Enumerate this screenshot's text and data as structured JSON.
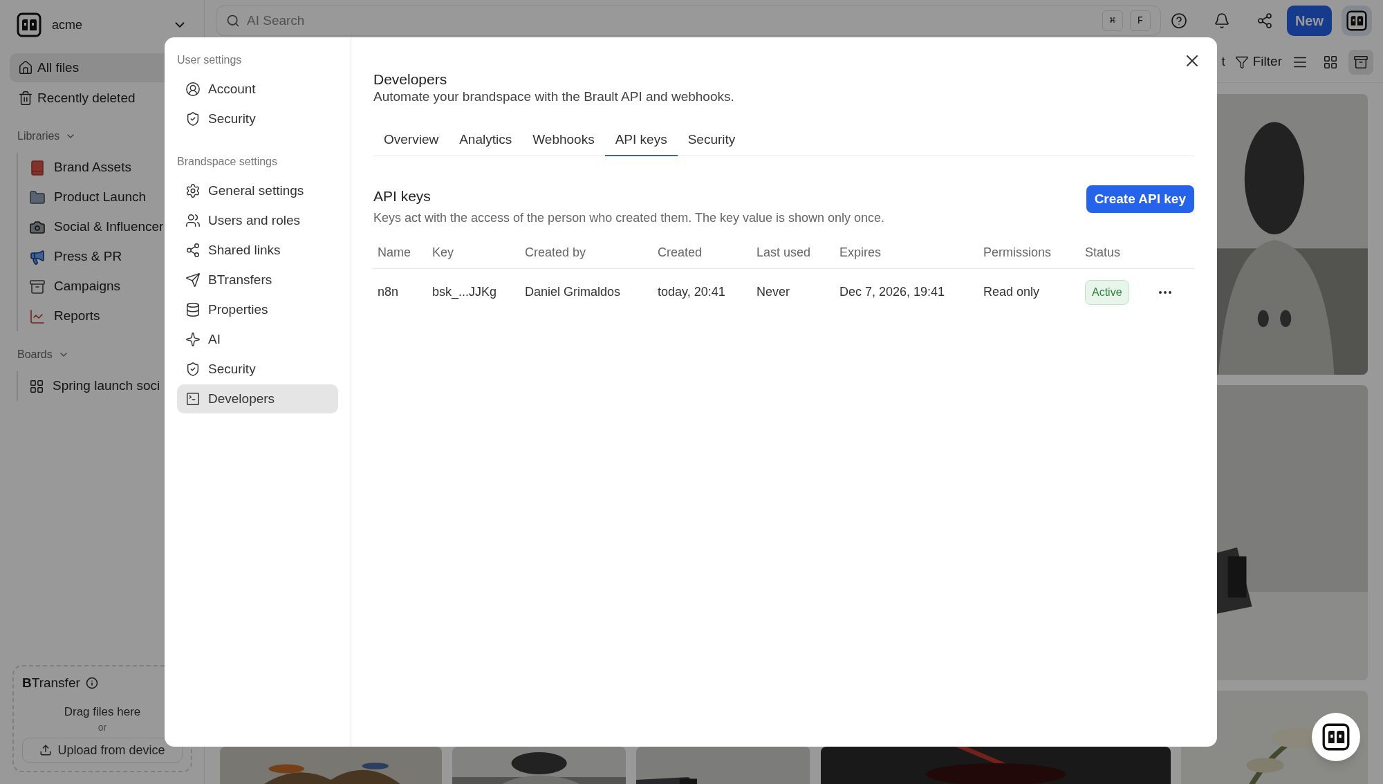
{
  "sidebar": {
    "workspace": "acme",
    "nav": [
      {
        "label": "All files",
        "selected": true
      },
      {
        "label": "Recently deleted",
        "selected": false
      }
    ],
    "sections": [
      {
        "title": "Libraries",
        "items": [
          "Brand Assets",
          "Product Launch",
          "Social & Influencer",
          "Press & PR",
          "Campaigns",
          "Reports"
        ]
      },
      {
        "title": "Boards",
        "items": [
          "Spring launch soci"
        ]
      }
    ],
    "btransfer": {
      "title": "**B**Transfer",
      "hint": "Drag files here",
      "or": "or",
      "button": "Upload from device"
    }
  },
  "topbar": {
    "search_placeholder": "AI Search",
    "keys": [
      "⌘",
      "F"
    ],
    "new_button": "New"
  },
  "toolbar": {
    "cut_text": "t",
    "filter": "Filter",
    "views": [
      {
        "selected": false
      },
      {
        "selected": false
      },
      {
        "selected": true
      }
    ]
  },
  "modal": {
    "nav": [
      {
        "title": "User settings",
        "items": [
          {
            "label": "Account",
            "selected": false
          },
          {
            "label": "Security",
            "selected": false
          }
        ]
      },
      {
        "title": "Brandspace settings",
        "items": [
          {
            "label": "General settings",
            "selected": false
          },
          {
            "label": "Users and roles",
            "selected": false
          },
          {
            "label": "Shared links",
            "selected": false
          },
          {
            "label": "BTransfers",
            "selected": false
          },
          {
            "label": "Properties",
            "selected": false
          },
          {
            "label": "AI",
            "selected": false
          },
          {
            "label": "Security",
            "selected": false
          },
          {
            "label": "Developers",
            "selected": true
          }
        ]
      }
    ],
    "title": "Developers",
    "subtitle": "Automate your brandspace with the Brault API and webhooks.",
    "tabs": [
      {
        "label": "Overview",
        "selected": false
      },
      {
        "label": "Analytics",
        "selected": false
      },
      {
        "label": "Webhooks",
        "selected": false
      },
      {
        "label": "API keys",
        "selected": true
      },
      {
        "label": "Security",
        "selected": false
      }
    ],
    "section": {
      "title": "API keys",
      "description": "Keys act with the access of the person who created them. The key value is shown only once.",
      "create_button": "Create API key"
    },
    "table": {
      "columns": [
        "Name",
        "Key",
        "Created by",
        "Created",
        "Last used",
        "Expires",
        "Permissions",
        "Status"
      ],
      "rows": [
        {
          "cells": [
            "n8n",
            "bsk_...JJKg",
            "Daniel Grimaldos",
            "today, 20:41",
            "Never",
            "Dec 7, 2026, 19:41",
            "Read only"
          ],
          "status": "Active"
        }
      ]
    }
  }
}
